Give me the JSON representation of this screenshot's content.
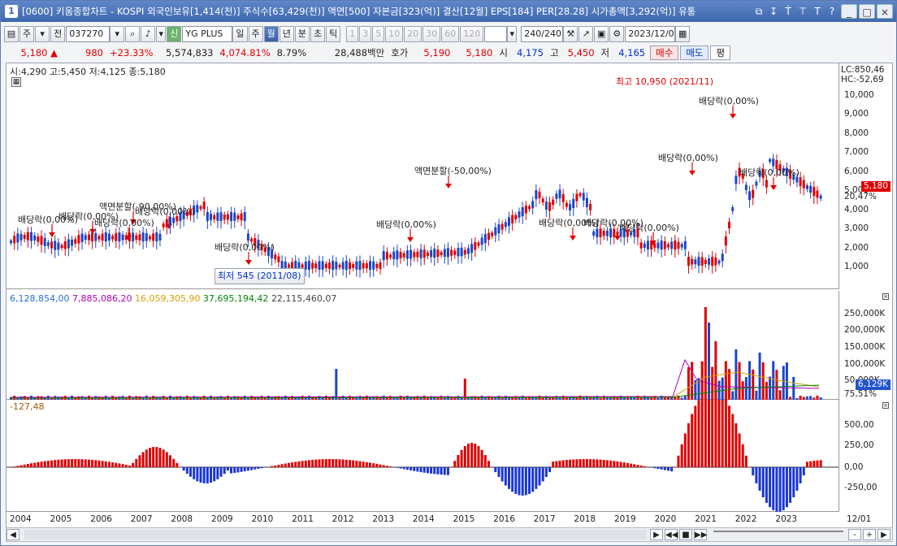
{
  "title": {
    "num": "1",
    "text": "[0600] 키움종합차트 - KOSPI 외국인보유[1,414(천)] 주식수[63,429(천)] 액면[500] 자본금[323(억)] 결산[12월] EPS[184] PER[28.28] 시가총액[3,292(억)] 유통",
    "icons": [
      "⧉",
      "↧",
      "Ṫ",
      "⊤",
      "T",
      "?"
    ],
    "controls": [
      "_",
      "□",
      "×"
    ]
  },
  "toolbar": {
    "period_labels": [
      "주",
      "전"
    ],
    "code": "037270",
    "stock_name": "YG PLUS",
    "stock_tag": "신",
    "tf_tabs": [
      "일",
      "주",
      "월",
      "년",
      "분",
      "초",
      "틱"
    ],
    "tf_selected": "월",
    "nums": [
      "1",
      "3",
      "5",
      "10",
      "20",
      "30",
      "60",
      "120"
    ],
    "count": "240/240",
    "date": "2023/12/01"
  },
  "quote": {
    "price": "5,180",
    "arrow": "▲",
    "change": "980",
    "rate": "+23.33%",
    "volume": "5,574,833",
    "vol_rate": "4,074.81%",
    "turnover": "8.79%",
    "amount": "28,488백만",
    "hoga_label": "호가",
    "hoga_ask": "5,190",
    "hoga_bid": "5,180",
    "open_label": "시",
    "open": "4,175",
    "high_label": "고",
    "high": "5,450",
    "low_label": "저",
    "low": "4,165",
    "buy": "매수",
    "sell": "매도",
    "avg": "평"
  },
  "price_panel": {
    "info": "시:4,290 고:5,450 저:4,125 종:5,180",
    "lc": "LC:850,46",
    "hc": "HC:-52,69",
    "last_price": "5,180",
    "last_rate": "20,47%",
    "y_ticks": [
      "10,000",
      "9,000",
      "8,000",
      "7,000",
      "6,000",
      "5,000",
      "4,000",
      "3,000",
      "2,000",
      "1,000"
    ],
    "annotations": [
      {
        "t": "배당락(0,00%)",
        "x": 14,
        "y": 184
      },
      {
        "t": "배당락(0,00%)",
        "x": 64,
        "y": 180
      },
      {
        "t": "배당락(0,00%)",
        "x": 108,
        "y": 188
      },
      {
        "t": "액면분할(-90,00%)",
        "x": 114,
        "y": 168
      },
      {
        "t": "배당락(0,00%)",
        "x": 158,
        "y": 174
      },
      {
        "t": "배당락(0,00%)",
        "x": 256,
        "y": 218
      },
      {
        "t": "배당락(0,00%)",
        "x": 455,
        "y": 190
      },
      {
        "t": "액면분할(-50,00%)",
        "x": 502,
        "y": 124
      },
      {
        "t": "배당락(0,00%)",
        "x": 655,
        "y": 188
      },
      {
        "t": "배당락(0,00%)",
        "x": 710,
        "y": 188
      },
      {
        "t": "배당락(0,00%)",
        "x": 754,
        "y": 194
      },
      {
        "t": "배당락(0,00%)",
        "x": 802,
        "y": 108
      },
      {
        "t": "배당락(0,00%)",
        "x": 852,
        "y": 38
      },
      {
        "t": "배당락(0,00%)",
        "x": 902,
        "y": 126
      }
    ],
    "high_note": "최고 10,950 (2021/11)",
    "low_note": "최저 545 (2011/08)"
  },
  "volume_panel": {
    "legend": [
      "6,128,854,00",
      "7,885,086,20",
      "16,059,305,90",
      "37,695,194,42",
      "22,115,460,07"
    ],
    "legend_colors": [
      "#2a6fd6",
      "#b000b0",
      "#d4a000",
      "#008800",
      "#444444"
    ],
    "y_ticks": [
      "250,000K",
      "200,000K",
      "150,000K",
      "100,000K",
      "50,000K"
    ],
    "last_vol": "6,129K",
    "last_pct": "75,51%"
  },
  "macd_panel": {
    "legend": "-127,48",
    "y_ticks": [
      "500,00",
      "250,00",
      "0,00",
      "-250,00"
    ]
  },
  "x_axis": {
    "years": [
      "2004",
      "2005",
      "2006",
      "2007",
      "2008",
      "2009",
      "2010",
      "2011",
      "2012",
      "2013",
      "2014",
      "2015",
      "2016",
      "2017",
      "2018",
      "2019",
      "2020",
      "2021",
      "2022",
      "2023"
    ],
    "end": "12/01"
  },
  "scroll": {
    "buttons": [
      "◀",
      "▶",
      "◀◀",
      "■",
      "▶▶",
      "-",
      "+",
      "▶"
    ]
  }
}
